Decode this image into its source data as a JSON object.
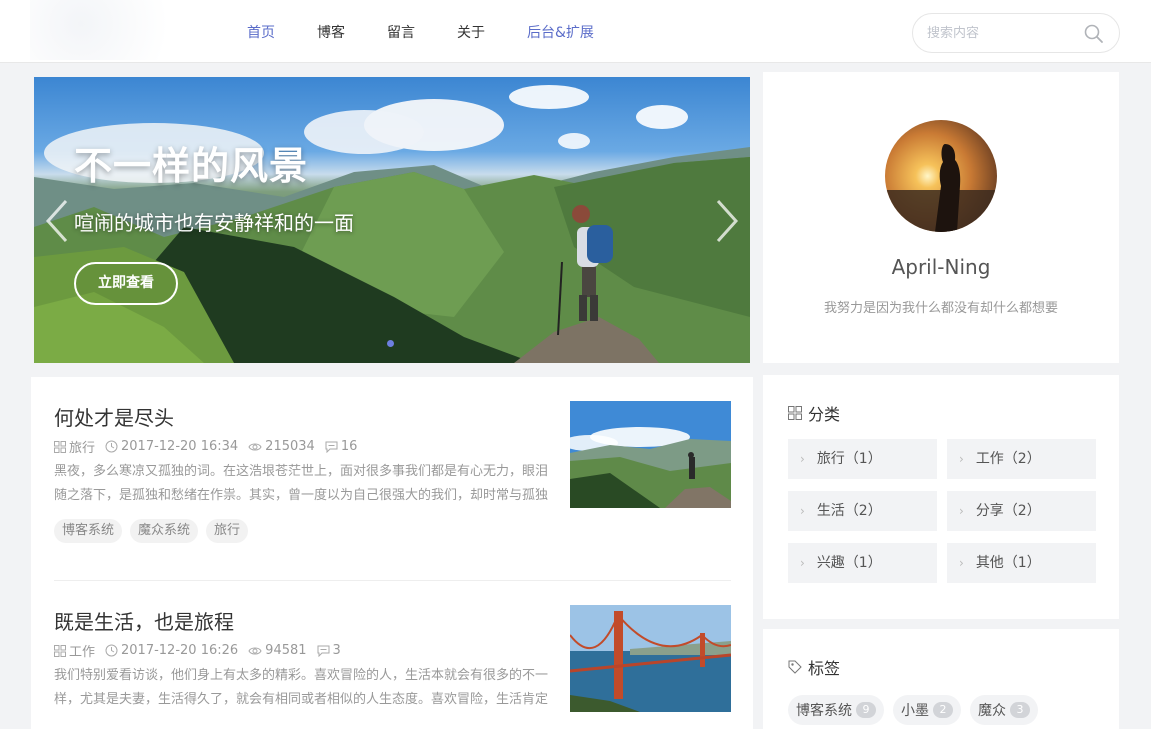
{
  "nav": {
    "items": [
      {
        "label": "首页"
      },
      {
        "label": "博客"
      },
      {
        "label": "留言"
      },
      {
        "label": "关于"
      },
      {
        "label": "后台&扩展"
      }
    ]
  },
  "search": {
    "placeholder": "搜索内容",
    "icon": "search-icon"
  },
  "banner": {
    "title": "不一样的风景",
    "subtitle": "喧闹的城市也有安静祥和的一面",
    "button_label": "立即查看"
  },
  "profile": {
    "name": "April-Ning",
    "motto": "我努力是因为我什么都没有却什么都想要"
  },
  "articles": [
    {
      "title": "何处才是尽头",
      "category": "旅行",
      "date": "2017-12-20 16:34",
      "views": "215034",
      "comments": "16",
      "excerpt": "黑夜，多么寒凉又孤独的词。在这浩垠苍茫世上，面对很多事我们都是有心无力，眼泪随之落下，是孤独和愁绪在作祟。其实，曾一度以为自己很强大的我们，却时常与孤独",
      "tags": [
        "博客系统",
        "魔众系统",
        "旅行"
      ]
    },
    {
      "title": "既是生活，也是旅程",
      "category": "工作",
      "date": "2017-12-20 16:26",
      "views": "94581",
      "comments": "3",
      "excerpt": "我们特别爱看访谈，他们身上有太多的精彩。喜欢冒险的人，生活本就会有很多的不一样，尤其是夫妻，生活得久了，就会有相同或者相似的人生态度。喜欢冒险，生活肯定",
      "tags": []
    }
  ],
  "category": {
    "heading": "分类",
    "items": [
      {
        "label": "旅行（1）"
      },
      {
        "label": "工作（2）"
      },
      {
        "label": "生活（2）"
      },
      {
        "label": "分享（2）"
      },
      {
        "label": "兴趣（1）"
      },
      {
        "label": "其他（1）"
      }
    ]
  },
  "tags": {
    "heading": "标签",
    "items": [
      {
        "label": "博客系统",
        "count": "9"
      },
      {
        "label": "小墨",
        "count": "2"
      },
      {
        "label": "魔众",
        "count": "3"
      }
    ]
  },
  "colors": {
    "accent": "#5a6cc9",
    "background": "#f2f3f5",
    "card": "#ffffff"
  }
}
